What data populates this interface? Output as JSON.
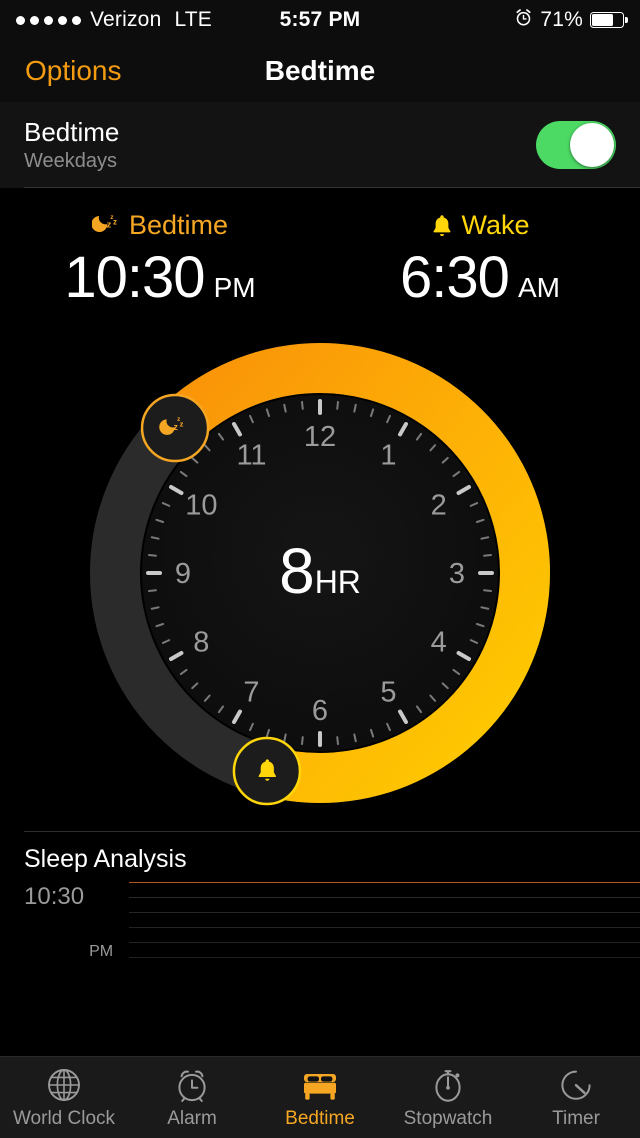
{
  "status_bar": {
    "signal_dots": 5,
    "carrier": "Verizon",
    "network": "LTE",
    "time": "5:57 PM",
    "alarm_icon": "alarm-clock-icon",
    "battery_percent": "71%",
    "battery_level": 71
  },
  "nav_bar": {
    "left_button": "Options",
    "title": "Bedtime"
  },
  "toggle_row": {
    "title": "Bedtime",
    "subtitle": "Weekdays",
    "switch_on": true,
    "switch_color": "#4cd964"
  },
  "times": {
    "bedtime": {
      "icon": "moon-zzz-icon",
      "label": "Bedtime",
      "time": "10:30",
      "ampm": "PM",
      "color": "#f5a623"
    },
    "wake": {
      "icon": "bell-icon",
      "label": "Wake",
      "time": "6:30",
      "ampm": "AM",
      "color": "#ffd60a"
    }
  },
  "dial": {
    "duration_number": "8",
    "duration_unit": "HR",
    "hour_labels": [
      "12",
      "1",
      "2",
      "3",
      "4",
      "5",
      "6",
      "7",
      "8",
      "9",
      "10",
      "11"
    ],
    "bedtime_handle_icon": "moon-zzz-handle-icon",
    "wake_handle_icon": "bell-handle-icon",
    "bedtime_angle_hours": 10.5,
    "wake_angle_hours": 6.5,
    "arc_start_color": "#f99208",
    "arc_end_color": "#ffcc00",
    "track_color": "#2b2b2b",
    "face_color": "#121212"
  },
  "chart_data": {
    "type": "line",
    "title": "Sleep Analysis",
    "y_tick_labels": [
      "10:30 PM"
    ],
    "x": [],
    "values": [],
    "grid": true,
    "gridline_colors": [
      "#b5551f",
      "#2a2a2a",
      "#262626",
      "#242424",
      "#222222",
      "#202020"
    ],
    "gridline_count": 6
  },
  "sleep_analysis": {
    "title": "Sleep Analysis",
    "time_label": "10:30",
    "time_ampm": "PM"
  },
  "tab_bar": {
    "items": [
      {
        "label": "World Clock",
        "icon": "globe-icon",
        "active": false
      },
      {
        "label": "Alarm",
        "icon": "alarm-clock-icon",
        "active": false
      },
      {
        "label": "Bedtime",
        "icon": "bed-icon",
        "active": true
      },
      {
        "label": "Stopwatch",
        "icon": "stopwatch-icon",
        "active": false
      },
      {
        "label": "Timer",
        "icon": "timer-icon",
        "active": false
      }
    ],
    "active_color": "#f5a623",
    "inactive_color": "#9a9a9a"
  }
}
